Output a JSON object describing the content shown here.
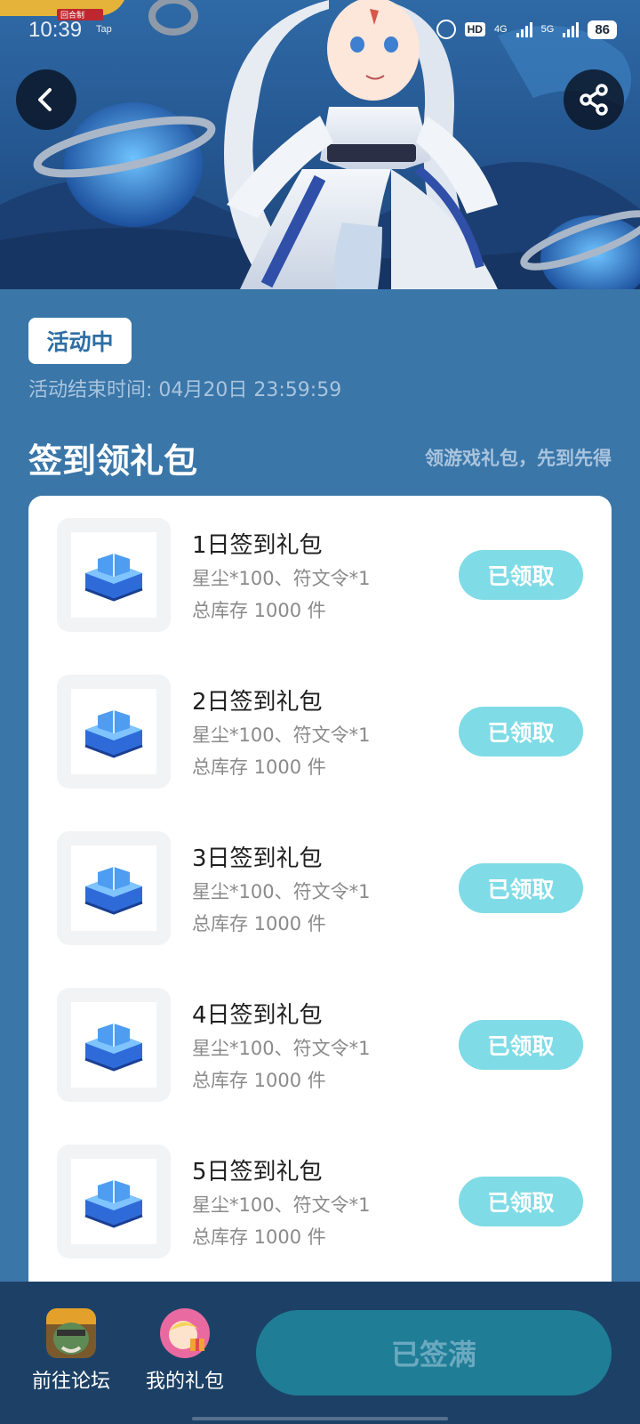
{
  "status_bar": {
    "time": "10:39",
    "tag": "Tap",
    "hd": "HD",
    "net_1": "4G",
    "net_2": "5G",
    "battery": "86"
  },
  "hero": {
    "banner_badge": "回合制",
    "back_icon": "chevron-left-icon",
    "share_icon": "share-icon"
  },
  "activity": {
    "status": "活动中",
    "end_time": "活动结束时间: 04月20日 23:59:59"
  },
  "section": {
    "title": "签到领礼包",
    "subtitle": "领游戏礼包，先到先得"
  },
  "gifts": [
    {
      "name": "1日签到礼包",
      "contents": "星尘*100、符文令*1",
      "stock": "总库存 1000 件",
      "button": "已领取"
    },
    {
      "name": "2日签到礼包",
      "contents": "星尘*100、符文令*1",
      "stock": "总库存 1000 件",
      "button": "已领取"
    },
    {
      "name": "3日签到礼包",
      "contents": "星尘*100、符文令*1",
      "stock": "总库存 1000 件",
      "button": "已领取"
    },
    {
      "name": "4日签到礼包",
      "contents": "星尘*100、符文令*1",
      "stock": "总库存 1000 件",
      "button": "已领取"
    },
    {
      "name": "5日签到礼包",
      "contents": "星尘*100、符文令*1",
      "stock": "总库存 1000 件",
      "button": "已领取"
    }
  ],
  "bottom_bar": {
    "forum_label": "前往论坛",
    "gifts_label": "我的礼包",
    "signin_label": "已签满"
  },
  "colors": {
    "page_bg": "#3a76a8",
    "claimed_button": "#7fdbe6",
    "bottom_bar": "#1d4166",
    "signin_button": "#1f7d96"
  }
}
